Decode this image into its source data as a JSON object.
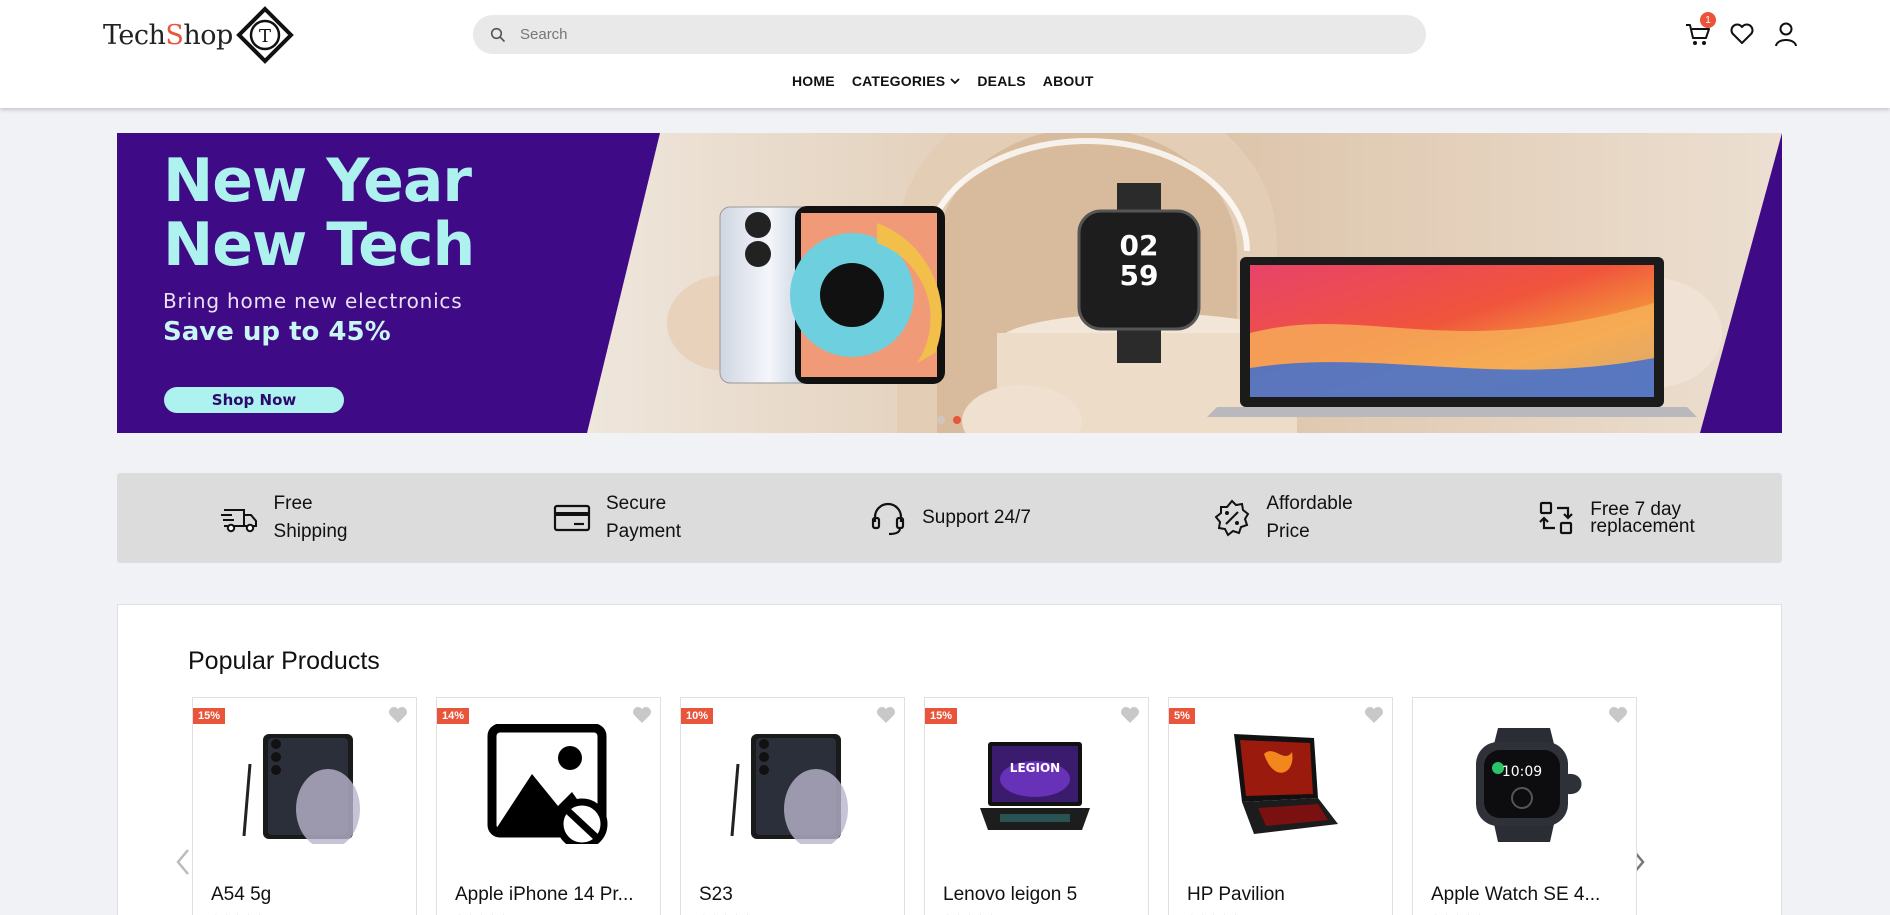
{
  "header": {
    "logo": {
      "prefix": "Tech",
      "accent": "S",
      "suffix": "hop",
      "mark_letter": "T"
    },
    "search": {
      "placeholder": "Search"
    },
    "cart_count": "1",
    "nav": [
      {
        "label": "HOME"
      },
      {
        "label": "CATEGORIES"
      },
      {
        "label": "DEALS"
      },
      {
        "label": "ABOUT"
      }
    ]
  },
  "banner": {
    "title_line1": "New Year",
    "title_line2": "New Tech",
    "subtitle": "Bring home new electronics",
    "save_text": "Save up to 45%",
    "button_label": "Shop Now",
    "watch_time_top": "02",
    "watch_time_bottom": "59"
  },
  "features": [
    {
      "line1": "Free",
      "line2": "Shipping",
      "icon": "truck-icon"
    },
    {
      "line1": "Secure",
      "line2": "Payment",
      "icon": "card-icon"
    },
    {
      "line1": "Support 24/7",
      "line2": "",
      "icon": "headset-icon"
    },
    {
      "line1": "Affordable",
      "line2": "Price",
      "icon": "discount-icon"
    },
    {
      "line1": "Free 7 day",
      "line2": "replacement",
      "icon": "exchange-icon"
    }
  ],
  "products": {
    "title": "Popular Products",
    "items": [
      {
        "badge": "15%",
        "name": "A54 5g",
        "image": "phone-image"
      },
      {
        "badge": "14%",
        "name": "Apple iPhone 14 Pr...",
        "image": "placeholder-image"
      },
      {
        "badge": "10%",
        "name": "S23",
        "image": "phone-image"
      },
      {
        "badge": "15%",
        "name": "Lenovo leigon 5",
        "image": "laptop-image",
        "screen_text": "LEGION"
      },
      {
        "badge": "5%",
        "name": "HP Pavilion",
        "image": "laptop-image"
      },
      {
        "badge": "",
        "name": "Apple Watch SE 4...",
        "image": "watch-image",
        "watch_time": "10:09"
      }
    ]
  },
  "colors": {
    "accent": "#e8553a",
    "banner_bg": "#3f0a85",
    "banner_text": "#aef2ef"
  }
}
